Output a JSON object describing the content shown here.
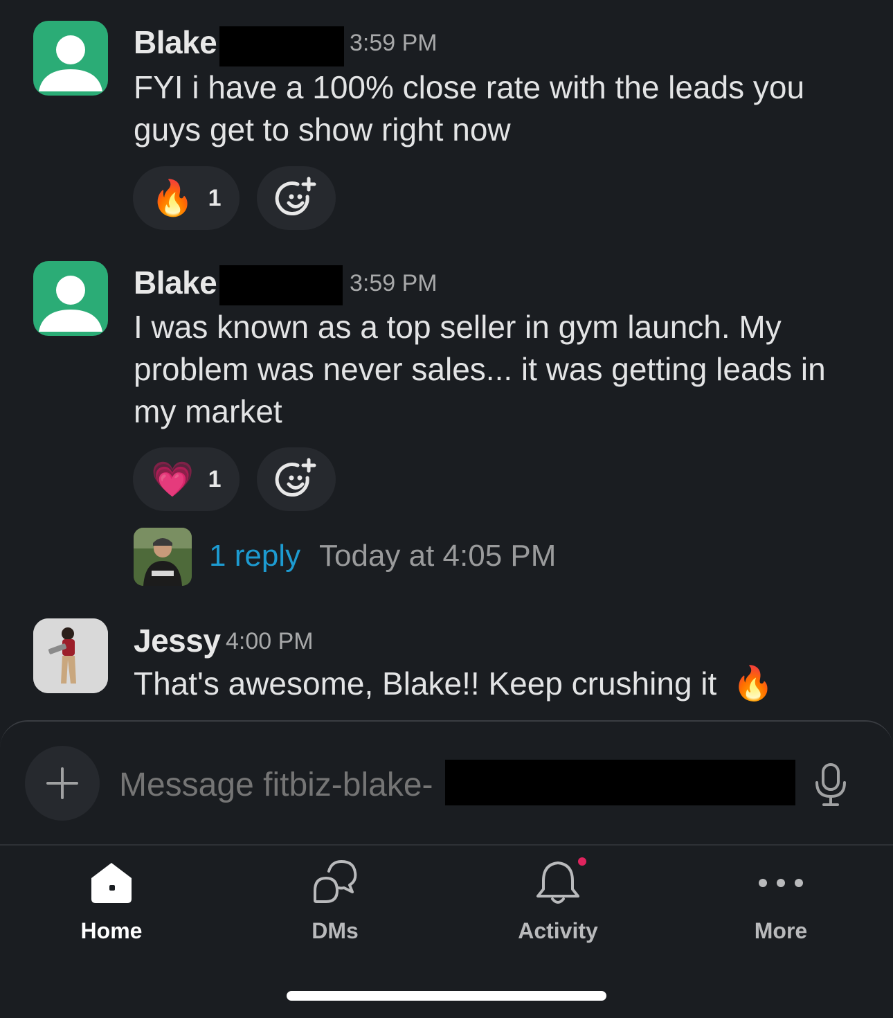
{
  "messages": [
    {
      "author": "Blake",
      "time": "3:59 PM",
      "text": "FYI i have a 100% close rate with the leads you guys get to show right now",
      "reaction": {
        "emoji": "🔥",
        "count": "1"
      }
    },
    {
      "author": "Blake",
      "time": "3:59 PM",
      "text": "I was known as a top seller in gym launch. My problem was never sales... it was getting leads in my market",
      "reaction": {
        "emoji": "💗",
        "count": "1"
      },
      "thread": {
        "reply_label": "1 reply",
        "last_reply": "Today at 4:05 PM"
      }
    },
    {
      "author": "Jessy",
      "time": "4:00 PM",
      "text": "That's awesome, Blake!! Keep crushing it",
      "trailing_emoji": "🔥"
    }
  ],
  "composer": {
    "placeholder": "Message fitbiz-blake-"
  },
  "tabs": [
    {
      "label": "Home",
      "icon": "home-icon",
      "active": true
    },
    {
      "label": "DMs",
      "icon": "dms-icon",
      "active": false
    },
    {
      "label": "Activity",
      "icon": "bell-icon",
      "active": false,
      "has_badge": true
    },
    {
      "label": "More",
      "icon": "more-icon",
      "active": false
    }
  ],
  "colors": {
    "background": "#1a1d21",
    "avatar_generic": "#2bac76",
    "link": "#1d9bd1",
    "badge": "#e0245e"
  }
}
